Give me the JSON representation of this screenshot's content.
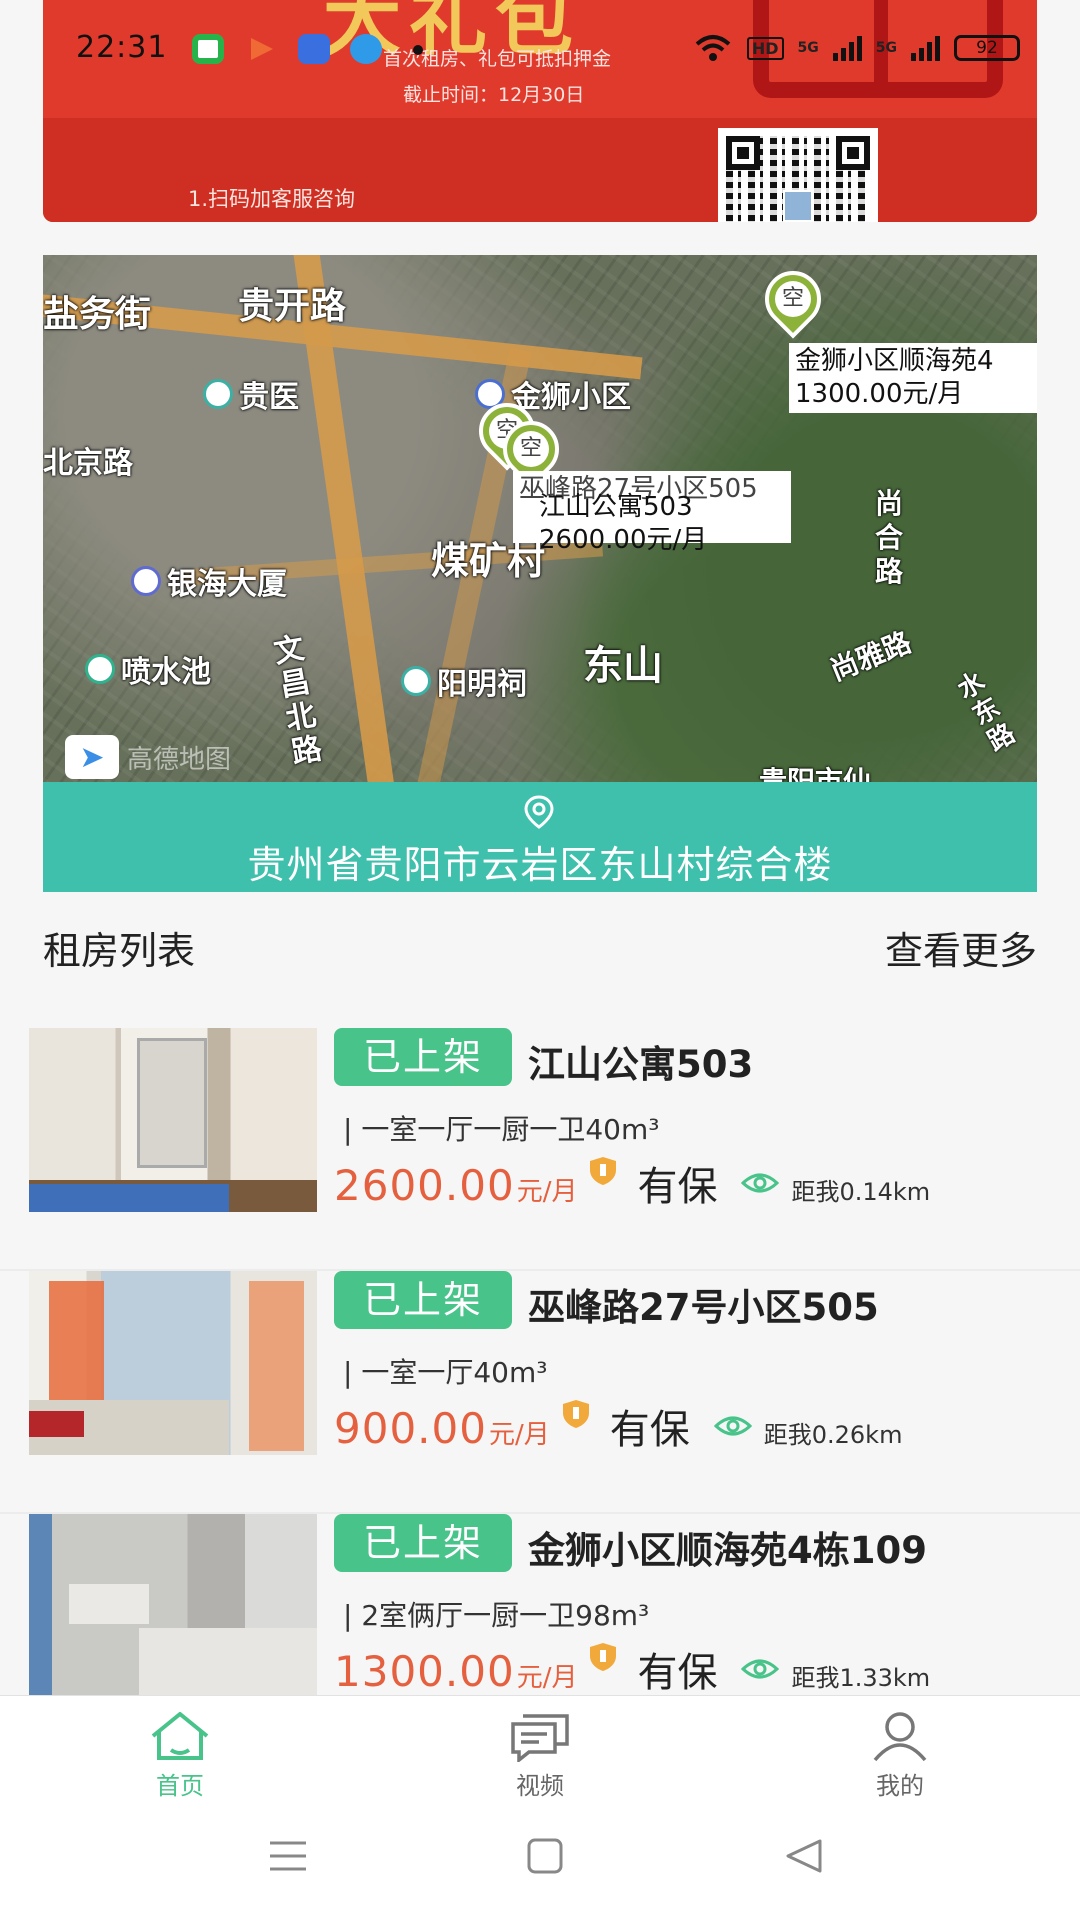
{
  "status_bar": {
    "time": "22:31",
    "battery": "92",
    "net1": "5G",
    "net2": "5G",
    "hd": "HD"
  },
  "banner": {
    "title_partial": "大礼包",
    "line1": "首次租房、礼包可抵扣押金",
    "line2": "截止时间：12月30日",
    "scan_text": "1.扫码加客服咨询"
  },
  "map": {
    "labels": [
      "盐务街",
      "贵开路",
      "贵医",
      "金狮小区",
      "北京路",
      "银海大厦",
      "煤矿村",
      "喷水池",
      "文昌北路",
      "阳明祠",
      "东山",
      "尚合路",
      "尚雅路",
      "水东路",
      "贵阳市仙",
      "高德地图"
    ],
    "pin_text": "空",
    "callout_top": {
      "name": "金狮小区顺海苑4",
      "price": "1300.00元/月"
    },
    "callout_mid_behind": "巫峰路27号小区505",
    "callout_mid": {
      "name": "江山公寓503",
      "price": "2600.00元/月"
    }
  },
  "address": "贵州省贵阳市云岩区东山村综合楼",
  "list_header": {
    "title": "租房列表",
    "more": "查看更多"
  },
  "listings": [
    {
      "status": "已上架",
      "title": "江山公寓503",
      "desc": "| 一室一厅一厨一卫40m³",
      "price": "2600.00",
      "unit": "元/月",
      "insured": "有保",
      "distance": "距我0.14km"
    },
    {
      "status": "已上架",
      "title": "巫峰路27号小区505",
      "desc": "| 一室一厅40m³",
      "price": "900.00",
      "unit": "元/月",
      "insured": "有保",
      "distance": "距我0.26km"
    },
    {
      "status": "已上架",
      "title": "金狮小区顺海苑4栋109",
      "desc": "| 2室俩厅一厨一卫98m³",
      "price": "1300.00",
      "unit": "元/月",
      "insured": "有保",
      "distance": "距我1.33km"
    }
  ],
  "tabs": [
    {
      "label": "首页",
      "active": true
    },
    {
      "label": "视频",
      "active": false
    },
    {
      "label": "我的",
      "active": false
    }
  ],
  "colors": {
    "accent": "#48c38a",
    "price": "#e5603e",
    "address_bar": "#3fc0ad",
    "banner": "#e03a2c"
  }
}
